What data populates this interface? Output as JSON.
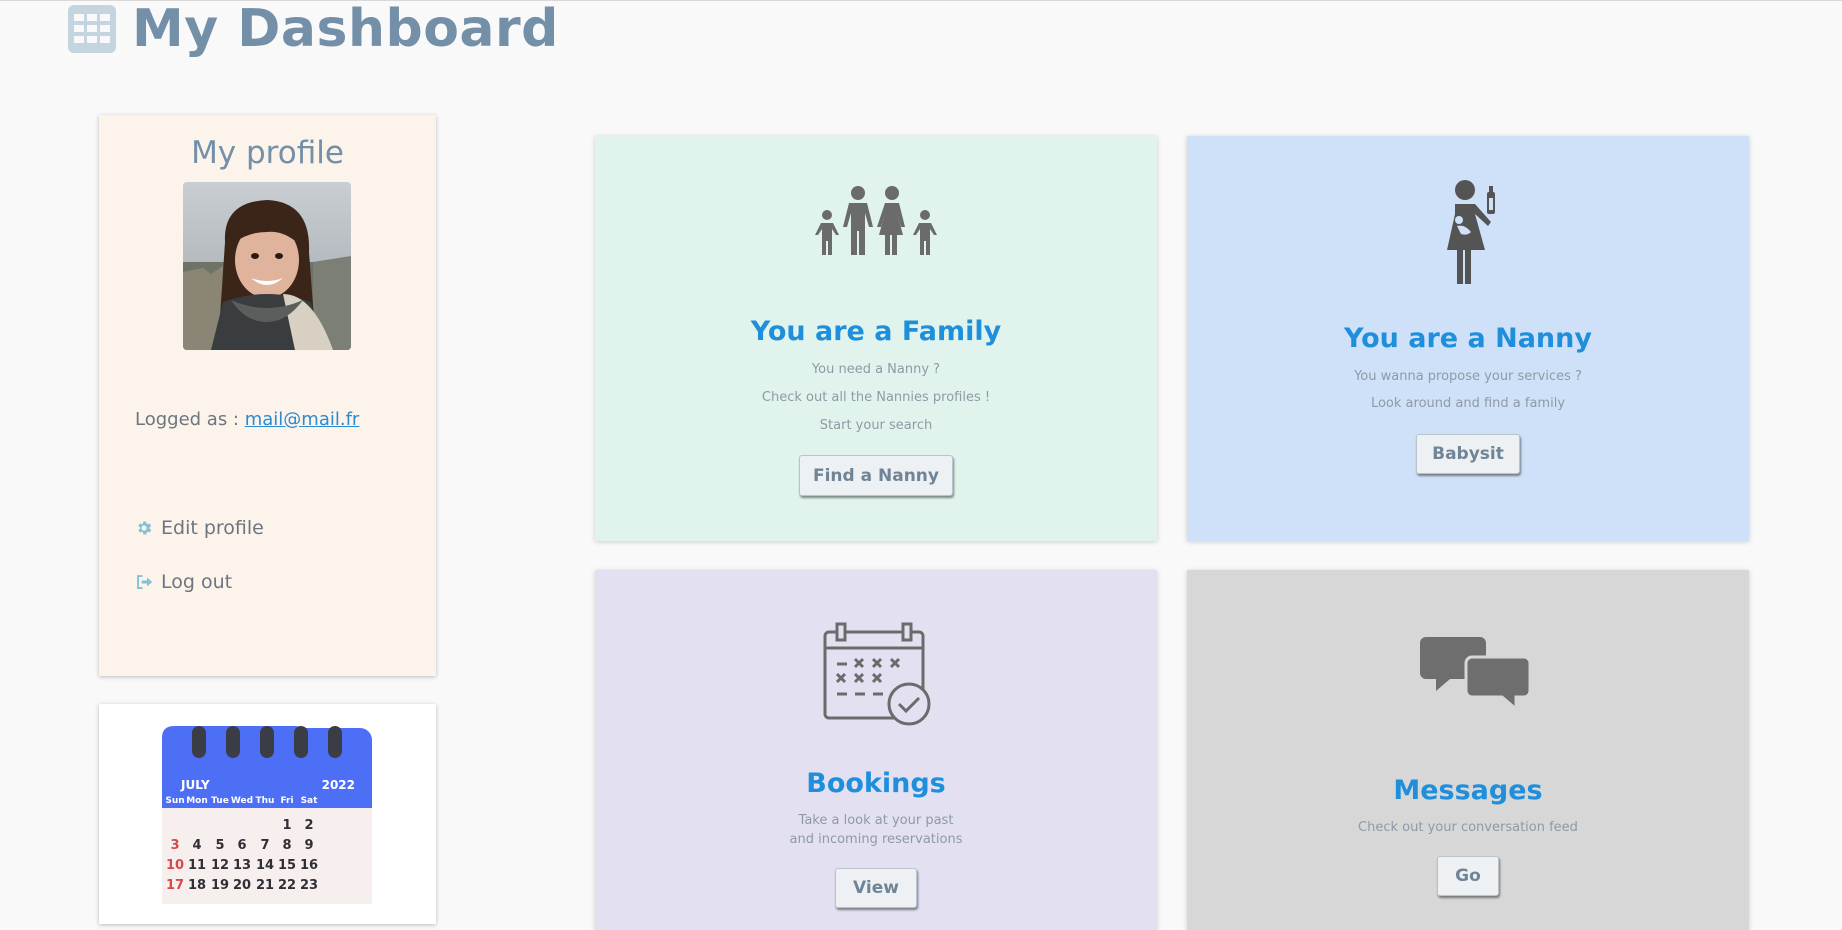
{
  "header": {
    "title": "My Dashboard",
    "icon": "calendar-grid-icon"
  },
  "profile": {
    "title": "My profile",
    "logged_label": "Logged as : ",
    "email": "mail@mail.fr",
    "edit_label": "Edit profile",
    "logout_label": "Log out"
  },
  "calendar": {
    "month": "JULY",
    "year": "2022",
    "days": [
      "Sun",
      "Mon",
      "Tue",
      "Wed",
      "Thu",
      "Fri",
      "Sat"
    ],
    "weeks": [
      [
        "",
        "",
        "",
        "",
        "",
        "1",
        "2"
      ],
      [
        "3",
        "4",
        "5",
        "6",
        "7",
        "8",
        "9"
      ],
      [
        "10",
        "11",
        "12",
        "13",
        "14",
        "15",
        "16"
      ],
      [
        "17",
        "18",
        "19",
        "20",
        "21",
        "22",
        "23"
      ]
    ]
  },
  "cards": {
    "family": {
      "title": "You are a Family",
      "line1": "You need a Nanny ?",
      "line2": "Check out all the Nannies profiles !",
      "line3": "Start your search",
      "button": "Find a Nanny"
    },
    "nanny": {
      "title": "You are a Nanny",
      "line1": "You wanna propose your services ?",
      "line2": "Look around and find a family",
      "button": "Babysit"
    },
    "bookings": {
      "title": "Bookings",
      "line1": "Take a look at your past",
      "line2": "and incoming reservations",
      "button": "View"
    },
    "messages": {
      "title": "Messages",
      "line1": "Check out your conversation feed",
      "button": "Go"
    }
  },
  "colors": {
    "family_bg": "#e0f4ed",
    "nanny_bg": "#cfe1f8",
    "bookings_bg": "#e3e0f2",
    "messages_bg": "#d7d7d7",
    "accent": "#1f8fdc",
    "calendar_header": "#4d6ff5"
  }
}
